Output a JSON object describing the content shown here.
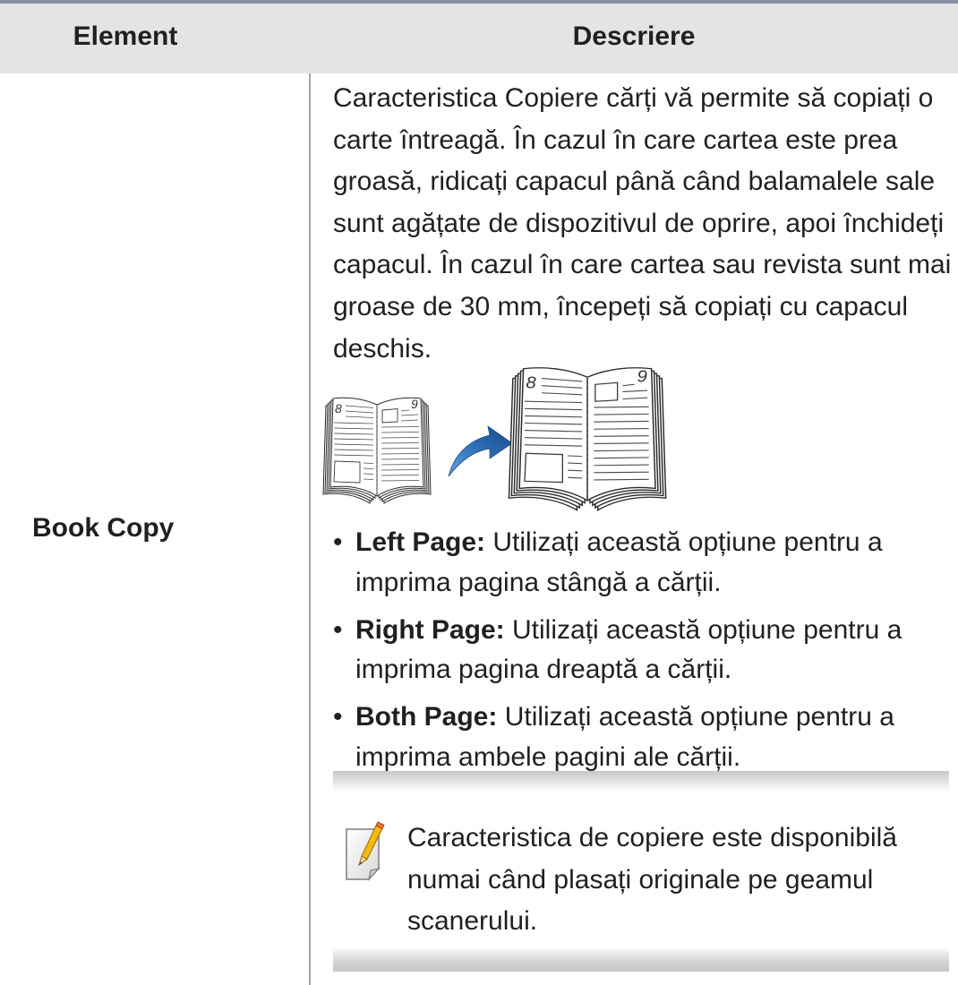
{
  "header": {
    "element_label": "Element",
    "description_label": "Descriere"
  },
  "row": {
    "element": "Book Copy",
    "description_lines": [
      "Caracteristica Copiere cărți vă permite să copiați o",
      "carte întreagă. În cazul în care cartea este prea",
      "groasă, ridicați capacul până când balamalele sale",
      "sunt agățate de dispozitivul de oprire, apoi închideți",
      "capacul. În cazul în care cartea sau revista sunt mai",
      "groase de 30 mm, începeți să copiați cu capacul",
      "deschis."
    ],
    "figure": {
      "left_page_number": "8",
      "right_page_number": "9",
      "arrow_icon": "curved-arrow-right-icon",
      "book_icon": "open-book-icon"
    },
    "bullet": "•",
    "options": [
      {
        "label": "Left Page:",
        "text_line1": "Utilizați această opțiune pentru a",
        "text_line2": "imprima pagina stângă a cărții."
      },
      {
        "label": "Right Page:",
        "text_line1": "Utilizați această opțiune pentru a",
        "text_line2": "imprima pagina dreaptă a cărții."
      },
      {
        "label": "Both Page:",
        "text_line1": "Utilizați această opțiune pentru a",
        "text_line2": "imprima ambele pagini ale cărții."
      }
    ],
    "note": {
      "icon": "note-pencil-icon",
      "lines": [
        "Caracteristica de copiere este disponibilă",
        "numai când plasați originale pe geamul",
        "scanerului."
      ]
    }
  },
  "colors": {
    "table_rule": "#8c8fa5",
    "header_background": "#e4e4e4",
    "text": "#231f20",
    "arrow": "#1f5b9f",
    "note_band": "#c7c7c7",
    "pencil": "#f6b910"
  }
}
